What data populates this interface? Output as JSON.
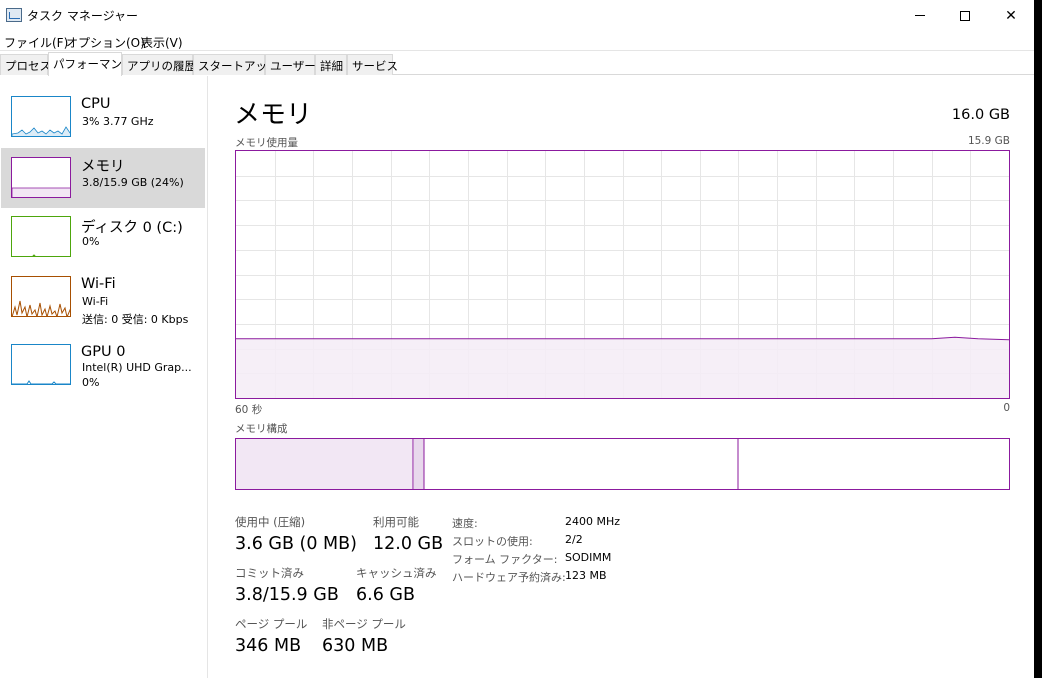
{
  "window": {
    "title": "タスク マネージャー",
    "controls": {
      "close": "✕"
    }
  },
  "menu": [
    "ファイル(F)",
    "オプション(O)",
    "表示(V)"
  ],
  "tabs": [
    {
      "label": "プロセス",
      "active": false
    },
    {
      "label": "パフォーマンス",
      "active": true
    },
    {
      "label": "アプリの履歴",
      "active": false
    },
    {
      "label": "スタートアップ",
      "active": false
    },
    {
      "label": "ユーザー",
      "active": false
    },
    {
      "label": "詳細",
      "active": false
    },
    {
      "label": "サービス",
      "active": false
    }
  ],
  "sidebar": [
    {
      "title": "CPU",
      "sub1": "3%  3.77 GHz",
      "color": "#1a86c8"
    },
    {
      "title": "メモリ",
      "sub1": "3.8/15.9 GB (24%)",
      "color": "#8b1a9e",
      "selected": true
    },
    {
      "title": "ディスク 0 (C:)",
      "sub1": "0%",
      "color": "#4da60c"
    },
    {
      "title": "Wi-Fi",
      "sub1": "Wi-Fi",
      "sub2": "送信: 0  受信: 0 Kbps",
      "color": "#a74f01"
    },
    {
      "title": "GPU 0",
      "sub1": "Intel(R) UHD Grap...",
      "sub2": "0%",
      "color": "#1a86c8"
    }
  ],
  "panel": {
    "title": "メモリ",
    "total": "16.0 GB",
    "usage_label": "メモリ使用量",
    "usage_max": "15.9 GB",
    "axis_left": "60 秒",
    "axis_right": "0",
    "composition_label": "メモリ構成",
    "accent": "#8b1a9e",
    "usage_level": 0.24,
    "stats": {
      "in_use_label": "使用中 (圧縮)",
      "in_use_value": "3.6 GB (0 MB)",
      "available_label": "利用可能",
      "available_value": "12.0 GB",
      "committed_label": "コミット済み",
      "committed_value": "3.8/15.9 GB",
      "cached_label": "キャッシュ済み",
      "cached_value": "6.6 GB",
      "paged_label": "ページ プール",
      "paged_value": "346 MB",
      "nonpaged_label": "非ページ プール",
      "nonpaged_value": "630 MB"
    },
    "details": [
      {
        "label": "速度:",
        "value": "2400 MHz"
      },
      {
        "label": "スロットの使用:",
        "value": "2/2"
      },
      {
        "label": "フォーム ファクター:",
        "value": "SODIMM"
      },
      {
        "label": "ハードウェア予約済み:",
        "value": "123 MB"
      }
    ]
  }
}
